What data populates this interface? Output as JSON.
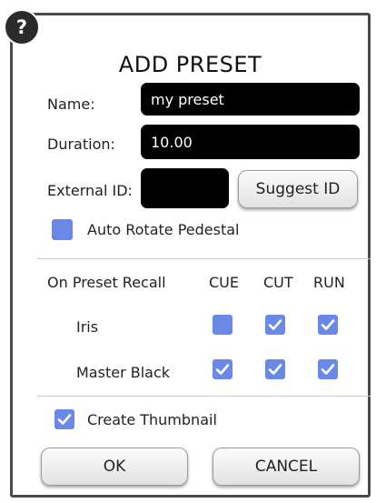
{
  "dialog": {
    "help_symbol": "?",
    "title": "ADD PRESET",
    "name_label": "Name:",
    "name_value": "my preset",
    "duration_label": "Duration:",
    "duration_value": "10.00",
    "external_id_label": "External ID:",
    "external_id_value": "",
    "suggest_id_label": "Suggest ID",
    "auto_rotate_label": "Auto Rotate Pedestal",
    "auto_rotate_checked": false,
    "recall": {
      "header_label": "On Preset Recall",
      "columns": [
        "CUE",
        "CUT",
        "RUN"
      ],
      "rows": [
        {
          "label": "Iris",
          "values": [
            false,
            true,
            true
          ]
        },
        {
          "label": "Master Black",
          "values": [
            true,
            true,
            true
          ]
        }
      ]
    },
    "create_thumbnail_label": "Create Thumbnail",
    "create_thumbnail_checked": true,
    "ok_label": "OK",
    "cancel_label": "CANCEL"
  },
  "colors": {
    "checkbox_fill": "#6a88e8",
    "checkmark": "#ffffff",
    "field_background": "#000000",
    "border": "#4a4a4a"
  },
  "icons": {
    "help": "question-mark-icon",
    "check": "checkmark-icon"
  }
}
